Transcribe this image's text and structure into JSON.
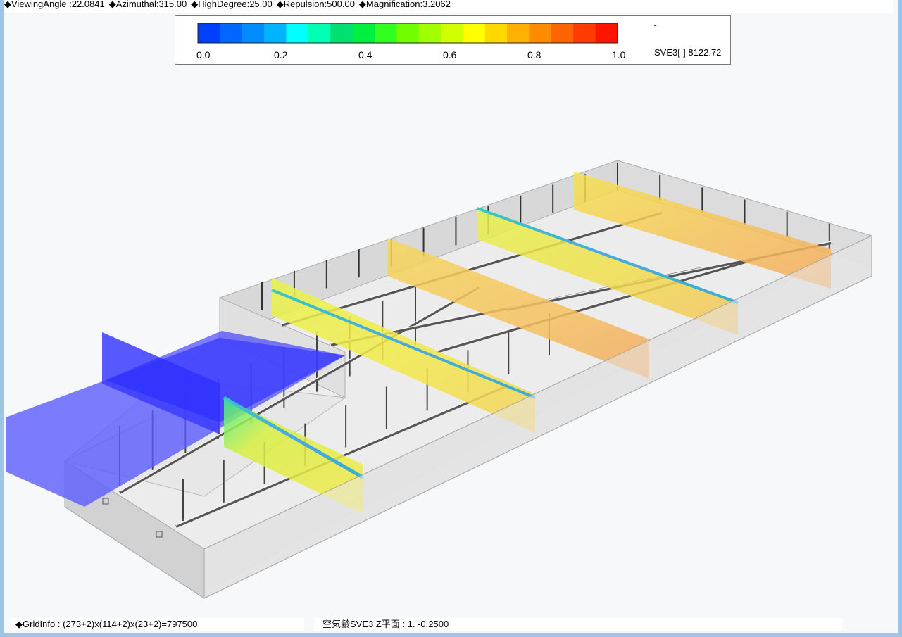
{
  "header": {
    "viewing_angle": "◆ViewingAngle :22.0841",
    "azimuthal": "◆Azimuthal:315.00",
    "high_degree": "◆HighDegree:25.00",
    "repulsion": "◆Repulsion:500.00",
    "magnification": "◆Magnification:3.2062"
  },
  "legend": {
    "ticks": [
      "0.0",
      "0.2",
      "0.4",
      "0.6",
      "0.8",
      "1.0"
    ],
    "variable_label": "SVE3[-] 8122.72",
    "marker": "˜",
    "colors": [
      "#0040ff",
      "#0066ff",
      "#008cff",
      "#00b4ff",
      "#00ffff",
      "#00ffb0",
      "#00e070",
      "#00f040",
      "#30ff20",
      "#70ff00",
      "#a0ff00",
      "#d0ff00",
      "#ffff00",
      "#ffd800",
      "#ffb000",
      "#ff8c00",
      "#ff6400",
      "#ff3c00",
      "#ff1400"
    ]
  },
  "footer": {
    "grid_info": "◆GridInfo : (273+2)x(114+2)x(23+2)=797500",
    "plane_info": "空気齢SVE3 Z平面 : 1.  -0.2500"
  }
}
